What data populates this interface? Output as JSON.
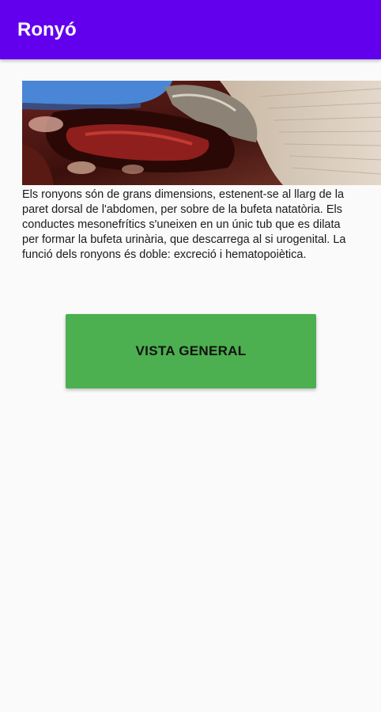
{
  "app_bar": {
    "title": "Ronyó",
    "color": "#6200ee"
  },
  "content": {
    "image_alt": "kidney-dissection-photo",
    "description": "Els ronyons són de grans dimensions, estenent-se al llarg de la paret dorsal de l'abdomen, per sobre de la bufeta natatòria. Els conductes mesonefrítics s'uneixen en un únic tub que es dilata per formar la bufeta urinària, que descarrega al si urogenital. La funció dels ronyons és doble: excreció i hematopoiètica.",
    "button_label": "VISTA GENERAL",
    "button_color": "#4caf50"
  }
}
